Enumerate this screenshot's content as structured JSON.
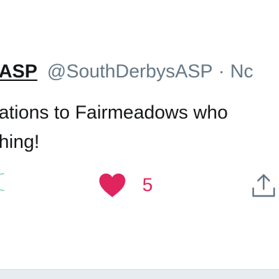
{
  "tweet": {
    "display_name": "ASP",
    "handle": "@SouthDerbysASP",
    "separator": "·",
    "date": "Nc",
    "text_line1": "ations to Fairmeadows who",
    "text_line2": "hing!"
  },
  "actions": {
    "like_count": "5",
    "reply_icon": "reply-icon",
    "like_icon": "heart-icon",
    "share_icon": "share-icon"
  },
  "colors": {
    "like": "#e0245e",
    "secondary_text": "#657786",
    "primary_text": "#14171a"
  }
}
